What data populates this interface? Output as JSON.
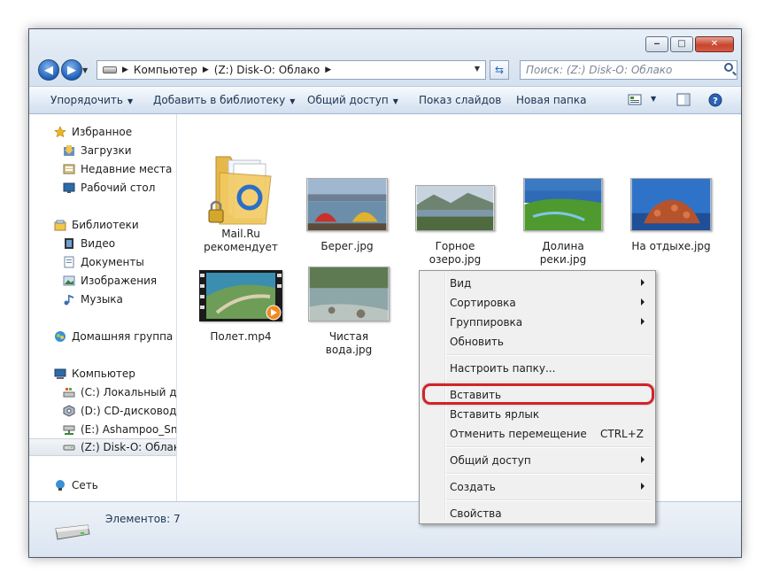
{
  "window": {
    "caption": {
      "minimize": "‒",
      "maximize": "□",
      "close": "✕"
    }
  },
  "navigation": {
    "back_glyph": "◀",
    "forward_glyph": "▶",
    "breadcrumbs": [
      "Компьютер",
      "(Z:) Disk-O: Облако"
    ],
    "search_placeholder": "Поиск: (Z:) Disk-O: Облако"
  },
  "toolbar": {
    "organize": "Упорядочить",
    "add_to_library": "Добавить в библиотеку",
    "share": "Общий доступ",
    "slideshow": "Показ слайдов",
    "new_folder": "Новая папка"
  },
  "sidebar": {
    "favorites": {
      "label": "Избранное",
      "items": [
        "Загрузки",
        "Недавние места",
        "Рабочий стол"
      ]
    },
    "libraries": {
      "label": "Библиотеки",
      "items": [
        "Видео",
        "Документы",
        "Изображения",
        "Музыка"
      ]
    },
    "homegroup": {
      "label": "Домашняя группа"
    },
    "computer": {
      "label": "Компьютер",
      "items": [
        "(C:) Локальный диск",
        "(D:) CD-дисковод - ",
        "(E:) Ashampoo_Snap",
        "(Z:) Disk-O: Облако"
      ]
    },
    "network": {
      "label": "Сеть"
    }
  },
  "files": [
    {
      "name_line1": "Mail.Ru",
      "name_line2": "рекомендует",
      "kind": "folder"
    },
    {
      "name_line1": "Берег.jpg",
      "name_line2": "",
      "kind": "image"
    },
    {
      "name_line1": "Горное",
      "name_line2": "озеро.jpg",
      "kind": "image"
    },
    {
      "name_line1": "Долина реки.jpg",
      "name_line2": "",
      "kind": "image"
    },
    {
      "name_line1": "На отдыхе.jpg",
      "name_line2": "",
      "kind": "image"
    },
    {
      "name_line1": "Полет.mp4",
      "name_line2": "",
      "kind": "video"
    },
    {
      "name_line1": "Чистая вода.jpg",
      "name_line2": "",
      "kind": "image"
    }
  ],
  "status": {
    "items_count": "Элементов: 7"
  },
  "context_menu": {
    "items": [
      {
        "label": "Вид",
        "shortcut": "",
        "submenu": true
      },
      {
        "label": "Сортировка",
        "shortcut": "",
        "submenu": true
      },
      {
        "label": "Группировка",
        "shortcut": "",
        "submenu": true
      },
      {
        "label": "Обновить",
        "shortcut": "",
        "submenu": false
      },
      {
        "label": "Настроить папку...",
        "shortcut": "",
        "submenu": false
      },
      {
        "label": "Вставить",
        "shortcut": "",
        "submenu": false
      },
      {
        "label": "Вставить ярлык",
        "shortcut": "",
        "submenu": false
      },
      {
        "label": "Отменить перемещение",
        "shortcut": "CTRL+Z",
        "submenu": false
      },
      {
        "label": "Общий доступ",
        "shortcut": "",
        "submenu": true
      },
      {
        "label": "Создать",
        "shortcut": "",
        "submenu": true
      },
      {
        "label": "Свойства",
        "shortcut": "",
        "submenu": false
      }
    ],
    "highlighted_item": "Вставить",
    "highlight_color": "#d2232a"
  }
}
